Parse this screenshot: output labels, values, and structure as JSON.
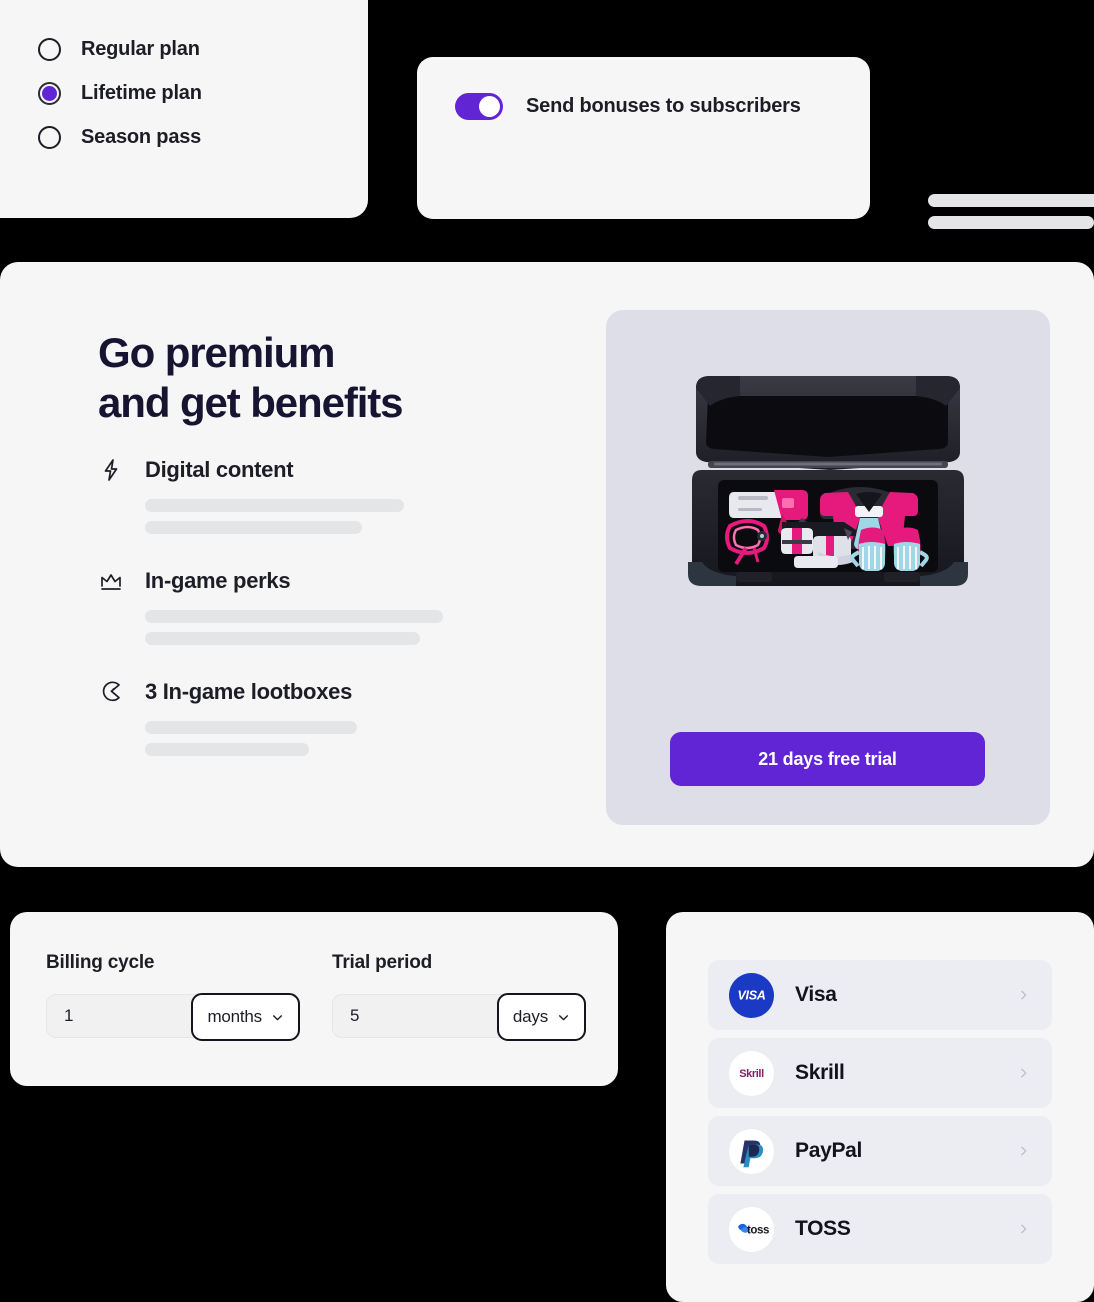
{
  "plan_card": {
    "options": [
      {
        "label": "Regular plan",
        "selected": false
      },
      {
        "label": "Lifetime plan",
        "selected": true
      },
      {
        "label": "Season pass",
        "selected": false
      }
    ]
  },
  "toggle_card": {
    "label": "Send bonuses to subscribers",
    "toggle_state": "on",
    "accent_color": "#6125d6"
  },
  "premium": {
    "title_line1": "Go premium",
    "title_line2": "and get benefits",
    "features": [
      {
        "title": "Digital content",
        "icon": "lightning-bolt-icon"
      },
      {
        "title": "In-game perks",
        "icon": "crown-icon"
      },
      {
        "title": "3 In-game lootboxes",
        "icon": "lootbox-icon"
      }
    ],
    "trial_button_label": "21 days free trial",
    "trial_button_color": "#6125d6",
    "image_card_color": "#dedee9",
    "product_image_alt": "open black equipment case with pink gear"
  },
  "billing": {
    "fields": [
      {
        "label": "Billing cycle",
        "value": "1",
        "unit": "months"
      },
      {
        "label": "Trial period",
        "value": "5",
        "unit": "days"
      }
    ]
  },
  "payments": {
    "methods": [
      {
        "name": "Visa",
        "logo": "visa-logo",
        "logo_color": "#1a39c4"
      },
      {
        "name": "Skrill",
        "logo": "skrill-logo",
        "logo_color": "#862165"
      },
      {
        "name": "PayPal",
        "logo": "paypal-logo",
        "logo_color": "#253b80"
      },
      {
        "name": "TOSS",
        "logo": "toss-logo",
        "logo_color": "#1b64da"
      }
    ]
  }
}
